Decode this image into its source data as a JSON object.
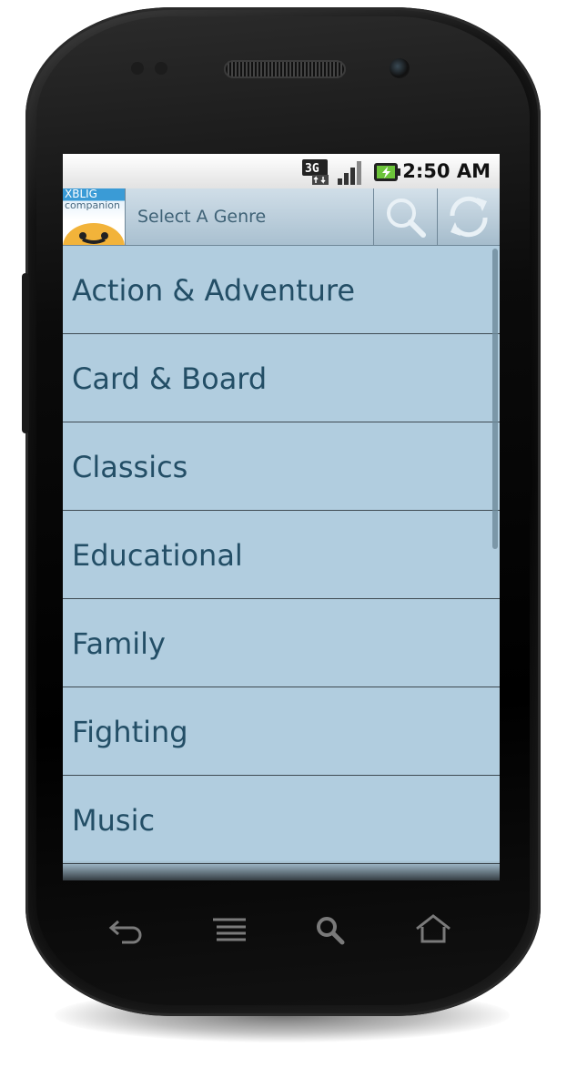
{
  "status_bar": {
    "time": "2:50 AM",
    "network_icon": "3g-data-icon",
    "signal_icon": "signal-strength-icon",
    "battery_icon": "battery-charging-icon"
  },
  "app_bar": {
    "logo": {
      "line1": "XBLIG",
      "line2": "companion"
    },
    "title": "Select A Genre",
    "search_icon": "search-icon",
    "refresh_icon": "refresh-icon"
  },
  "genres": [
    "Action & Adventure",
    "Card & Board",
    "Classics",
    "Educational",
    "Family",
    "Fighting",
    "Music"
  ],
  "nav_keys": [
    "back-icon",
    "menu-icon",
    "search-icon",
    "home-icon"
  ],
  "colors": {
    "list_background": "#b1cddf",
    "list_text": "#234e66",
    "title_text": "#3f6276"
  }
}
